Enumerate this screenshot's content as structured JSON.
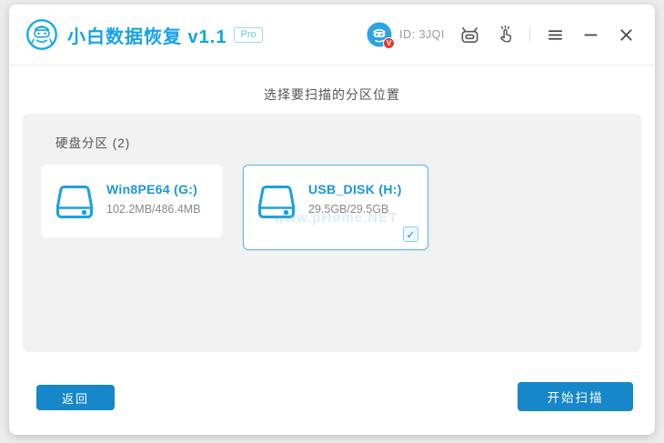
{
  "titlebar": {
    "app_title": "小白数据恢复 v1.1",
    "pro_badge": "Pro",
    "user_id": "ID: 3JQI",
    "avatar_badge_letter": "V"
  },
  "main": {
    "heading": "选择要扫描的分区位置",
    "partition_panel": {
      "label": "硬盘分区 (2)",
      "drives": [
        {
          "name": "Win8PE64  (G:)",
          "capacity": "102.2MB/486.4MB",
          "selected": false
        },
        {
          "name": "USB_DISK  (H:)",
          "capacity": "29.5GB/29.5GB",
          "selected": true
        }
      ],
      "watermark": "www.pHome.NET",
      "check_glyph": "✓"
    }
  },
  "footer": {
    "back_button": "返回",
    "start_button": "开始扫描"
  },
  "colors": {
    "accent_blue": "#14a3e8",
    "button_blue": "#1687c8",
    "selected_border": "#5fb8e8",
    "drive_name_blue": "#1897dd",
    "badge_red": "#e23b30",
    "text_gray": "#888888"
  }
}
